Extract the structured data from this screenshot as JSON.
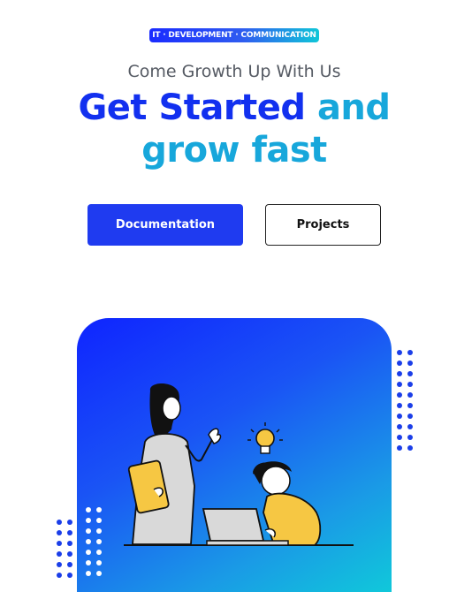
{
  "hero": {
    "badge": "IT · DEVELOPMENT · COMMUNICATION",
    "subtitle": "Come Growth Up With Us",
    "headline_part1": "Get Started",
    "headline_part2": "and",
    "headline_line2": "grow fast"
  },
  "actions": {
    "primary_label": "Documentation",
    "secondary_label": "Projects"
  },
  "colors": {
    "brand_blue": "#1230ef",
    "accent_cyan": "#17a7db",
    "button_blue": "#1f3bf0"
  },
  "icons": [
    "lightbulb-icon"
  ]
}
